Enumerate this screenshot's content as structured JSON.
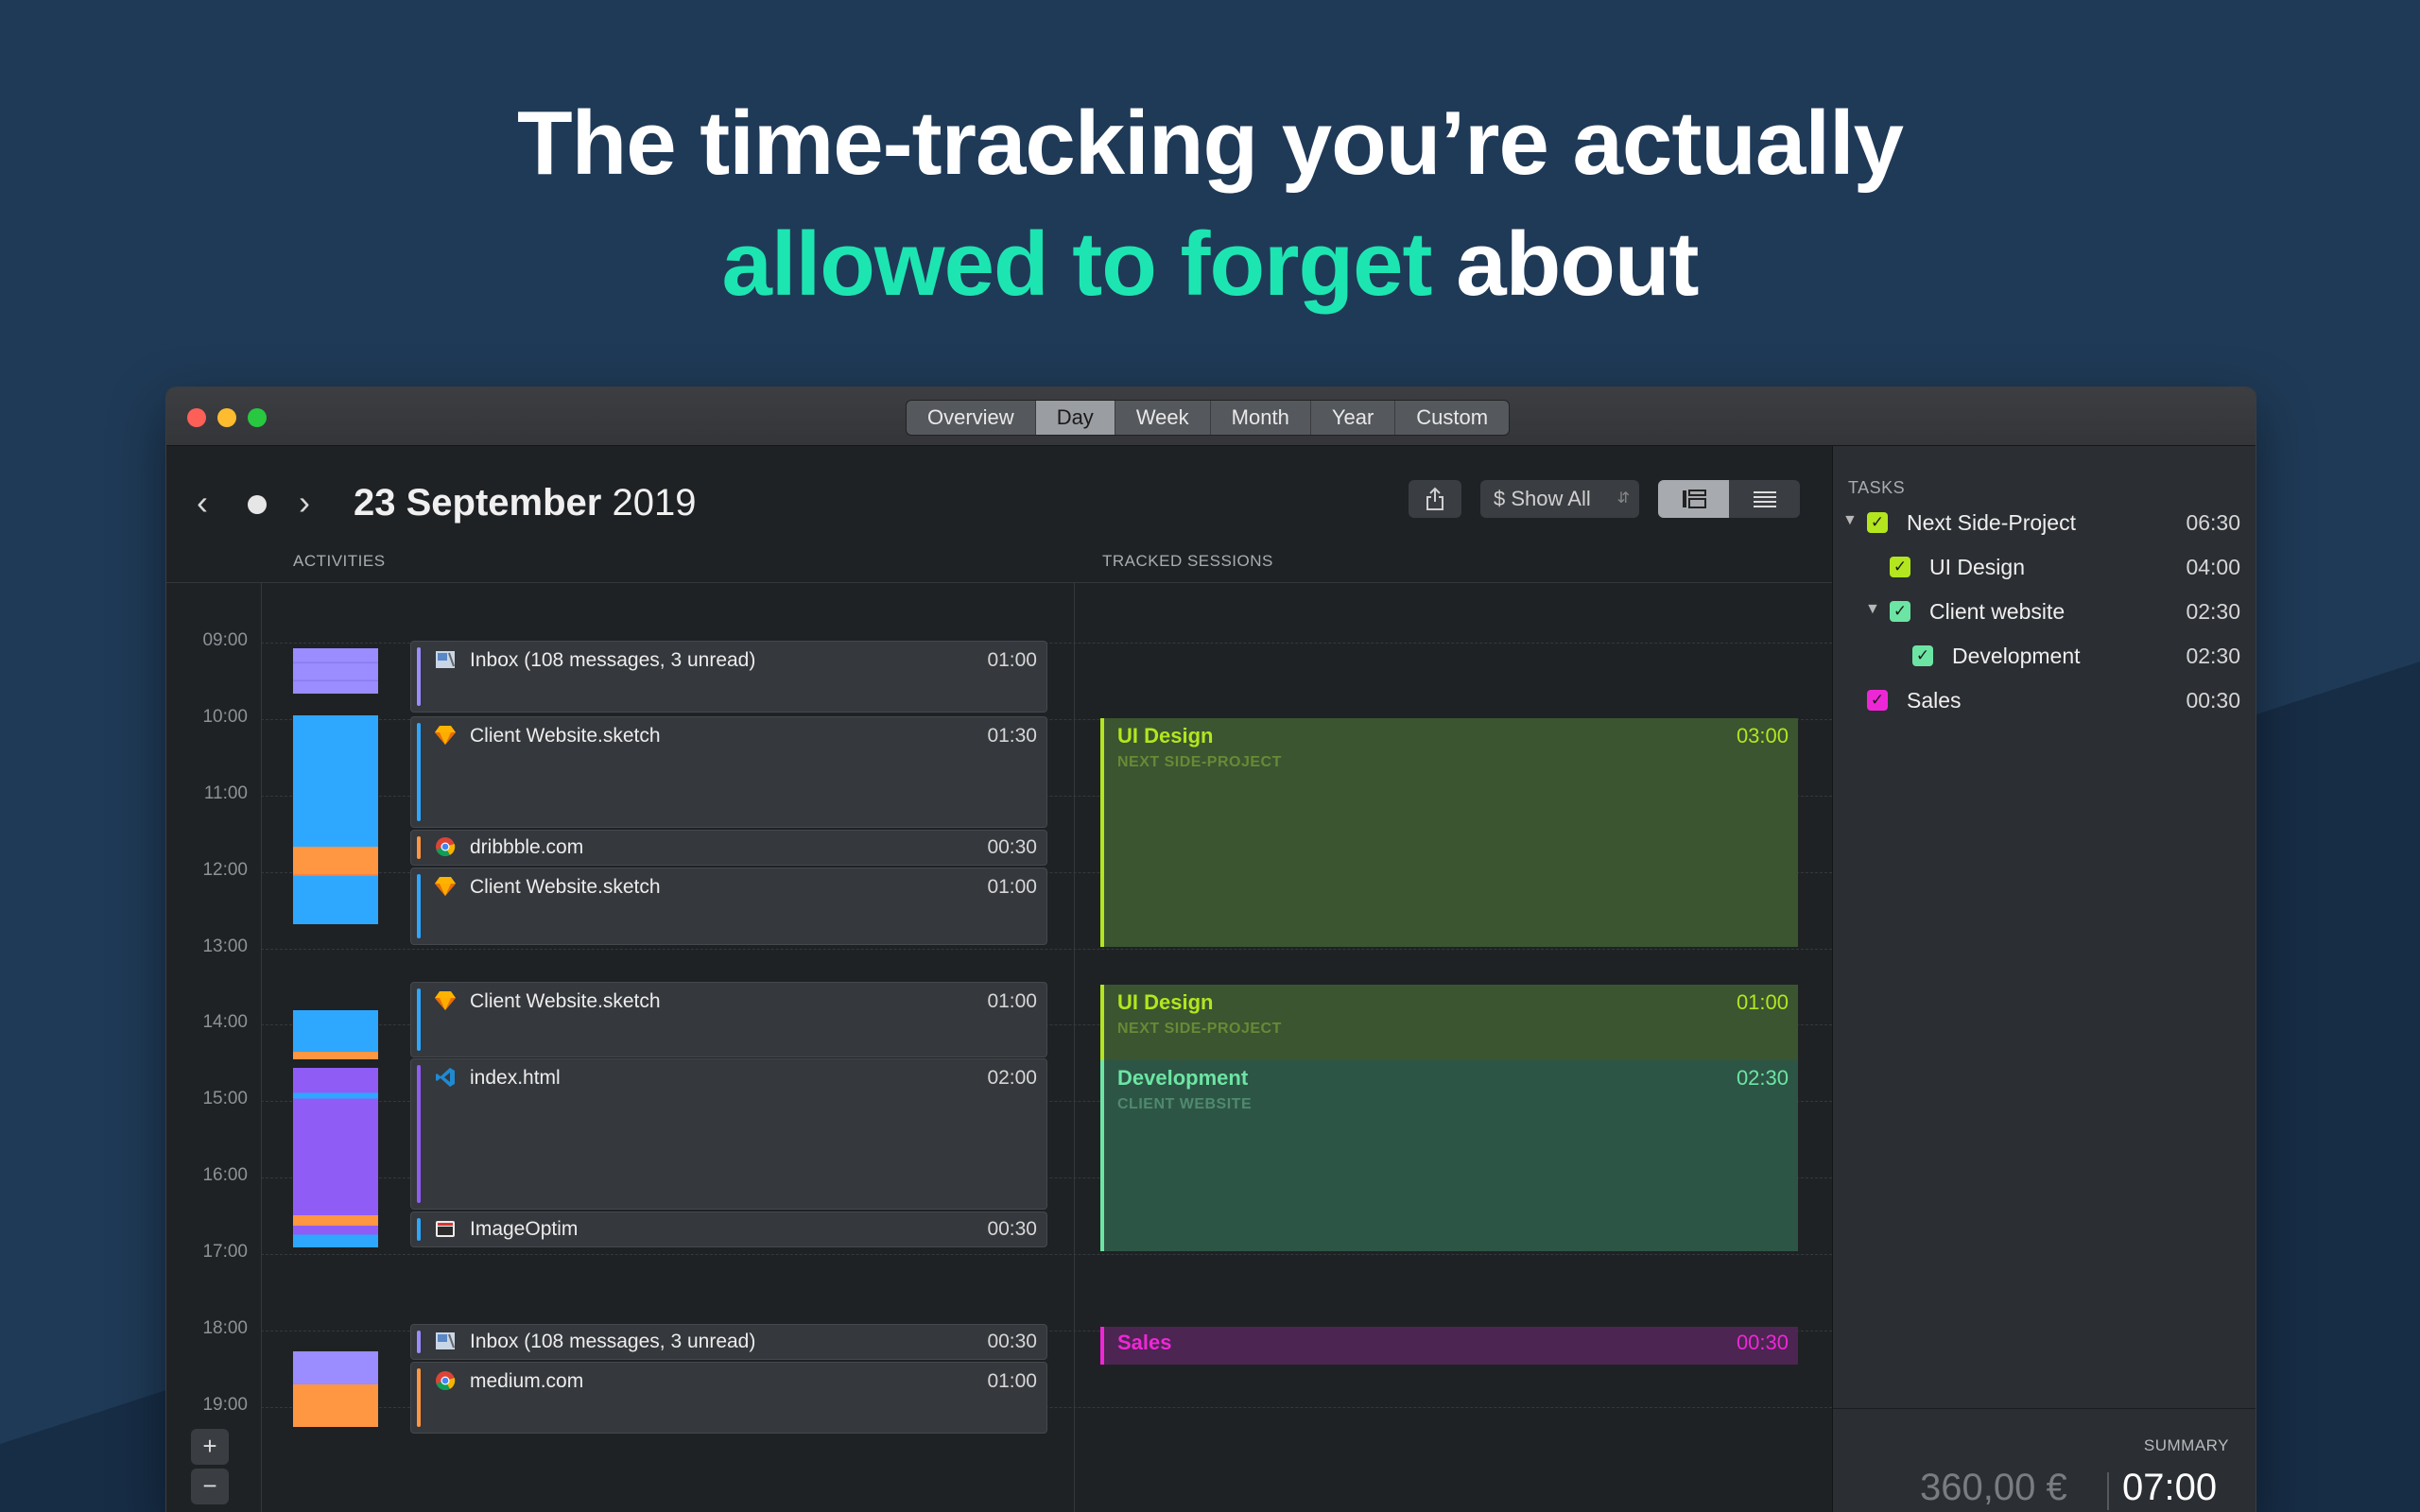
{
  "headline": {
    "line1": "The time-tracking you’re actually",
    "accent": "allowed to forget",
    "tail": " about"
  },
  "colors": {
    "accent": "#1de5b2",
    "ui_design": "#b3e61e",
    "development": "#6ce5a4",
    "sales": "#ee27d6",
    "blue": "#2ea7ff",
    "purple": "#8f5cf6",
    "lavender": "#9b8cff",
    "orange": "#ff9642"
  },
  "toolbar": {
    "segments": [
      "Overview",
      "Day",
      "Week",
      "Month",
      "Year",
      "Custom"
    ],
    "active_segment": "Day",
    "prev_icon": "chevron-left-icon",
    "next_icon": "chevron-right-icon",
    "date_day_month": "23 September",
    "date_year": "2019",
    "share_icon": "share-icon",
    "show_all_label": "$  Show All"
  },
  "columns": {
    "activities": "ACTIVITIES",
    "tracked_sessions": "TRACKED SESSIONS"
  },
  "hours": [
    "09:00",
    "10:00",
    "11:00",
    "12:00",
    "13:00",
    "14:00",
    "15:00",
    "16:00",
    "17:00",
    "18:00",
    "19:00"
  ],
  "activities": [
    {
      "icon": "mail-icon",
      "label": "Inbox (108 messages, 3 unread)",
      "duration": "01:00"
    },
    {
      "icon": "sketch-icon",
      "label": "Client Website.sketch",
      "duration": "01:30"
    },
    {
      "icon": "chrome-icon",
      "label": "dribbble.com",
      "duration": "00:30"
    },
    {
      "icon": "sketch-icon",
      "label": "Client Website.sketch",
      "duration": "01:00"
    },
    {
      "icon": "sketch-icon",
      "label": "Client Website.sketch",
      "duration": "01:00"
    },
    {
      "icon": "vscode-icon",
      "label": "index.html",
      "duration": "02:00"
    },
    {
      "icon": "imageoptim-icon",
      "label": "ImageOptim",
      "duration": "00:30"
    },
    {
      "icon": "mail-icon",
      "label": "Inbox (108 messages, 3 unread)",
      "duration": "00:30"
    },
    {
      "icon": "chrome-icon",
      "label": "medium.com",
      "duration": "01:00"
    }
  ],
  "sessions": [
    {
      "title": "UI Design",
      "subtitle": "NEXT SIDE-PROJECT",
      "duration": "03:00"
    },
    {
      "title": "UI Design",
      "subtitle": "NEXT SIDE-PROJECT",
      "duration": "01:00"
    },
    {
      "title": "Development",
      "subtitle": "CLIENT WEBSITE",
      "duration": "02:30"
    },
    {
      "title": "Sales",
      "subtitle": "",
      "duration": "00:30"
    }
  ],
  "sidebar": {
    "heading": "TASKS",
    "tasks": [
      {
        "name": "Next Side-Project",
        "duration": "06:30"
      },
      {
        "name": "UI Design",
        "duration": "04:00"
      },
      {
        "name": "Client website",
        "duration": "02:30"
      },
      {
        "name": "Development",
        "duration": "02:30"
      },
      {
        "name": "Sales",
        "duration": "00:30"
      }
    ],
    "summary_heading": "SUMMARY",
    "summary_money": "360,00 €",
    "summary_time": "07:00"
  },
  "zoom": {
    "plus": "+",
    "minus": "−"
  }
}
